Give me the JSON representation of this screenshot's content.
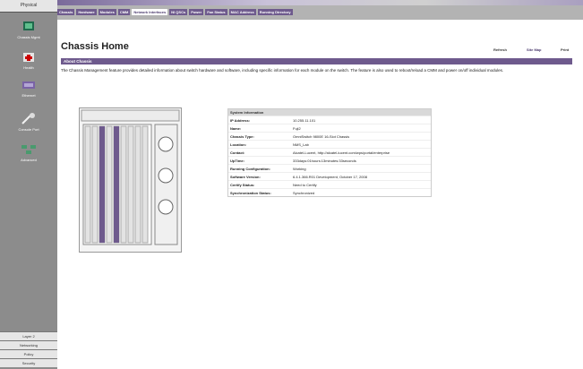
{
  "sidebar": {
    "top_tab": "Physical",
    "items": [
      {
        "label": "Chassis Mgmt"
      },
      {
        "label": "Health"
      },
      {
        "label": "Ethernet"
      },
      {
        "label": "Console Port"
      },
      {
        "label": "Advanced"
      }
    ],
    "bottom_tabs": [
      "Layer 2",
      "Networking",
      "Policy",
      "Security"
    ]
  },
  "topbar": {
    "tabs": [
      "Chassis",
      "Hardware",
      "Modules",
      "CMM",
      "Network Interfaces",
      "NI QSCs",
      "Power",
      "Fan Status",
      "MAC Address",
      "Running Directory"
    ],
    "active_index": 4
  },
  "page": {
    "title": "Chassis Home",
    "links": [
      "Refresh",
      "Site Map",
      "Print"
    ],
    "section_title": "About Chassis",
    "description": "The Chassis Management feature provides detailed information about switch hardware and software, including specific information for each module on the switch. The feature is also used to reboot/reload a CMM and power on/off individual modules."
  },
  "system_info": {
    "title": "System Information",
    "rows": [
      {
        "key": "IP Address:",
        "value": "10.255.11.101"
      },
      {
        "key": "Name:",
        "value": "Fuji2"
      },
      {
        "key": "Chassis Type:",
        "value": "OmniSwitch 9800E 16-Slot Chassis"
      },
      {
        "key": "Location:",
        "value": "NMS_Lab"
      },
      {
        "key": "Contact:",
        "value": "Alcatel-Lucent, http://alcatel-lucent.com/wps/portal/enterprise"
      },
      {
        "key": "UpTime:",
        "value": "333days:01hours:13minutes:33seconds"
      },
      {
        "key": "Running Configuration:",
        "value": "Working"
      },
      {
        "key": "Software Version:",
        "value": "6.4.1.366.R01 Development, October 17, 2008"
      },
      {
        "key": "Certify Status:",
        "value": "Need to Certify"
      },
      {
        "key": "Synchronization Status:",
        "value": "Synchronized"
      }
    ]
  }
}
